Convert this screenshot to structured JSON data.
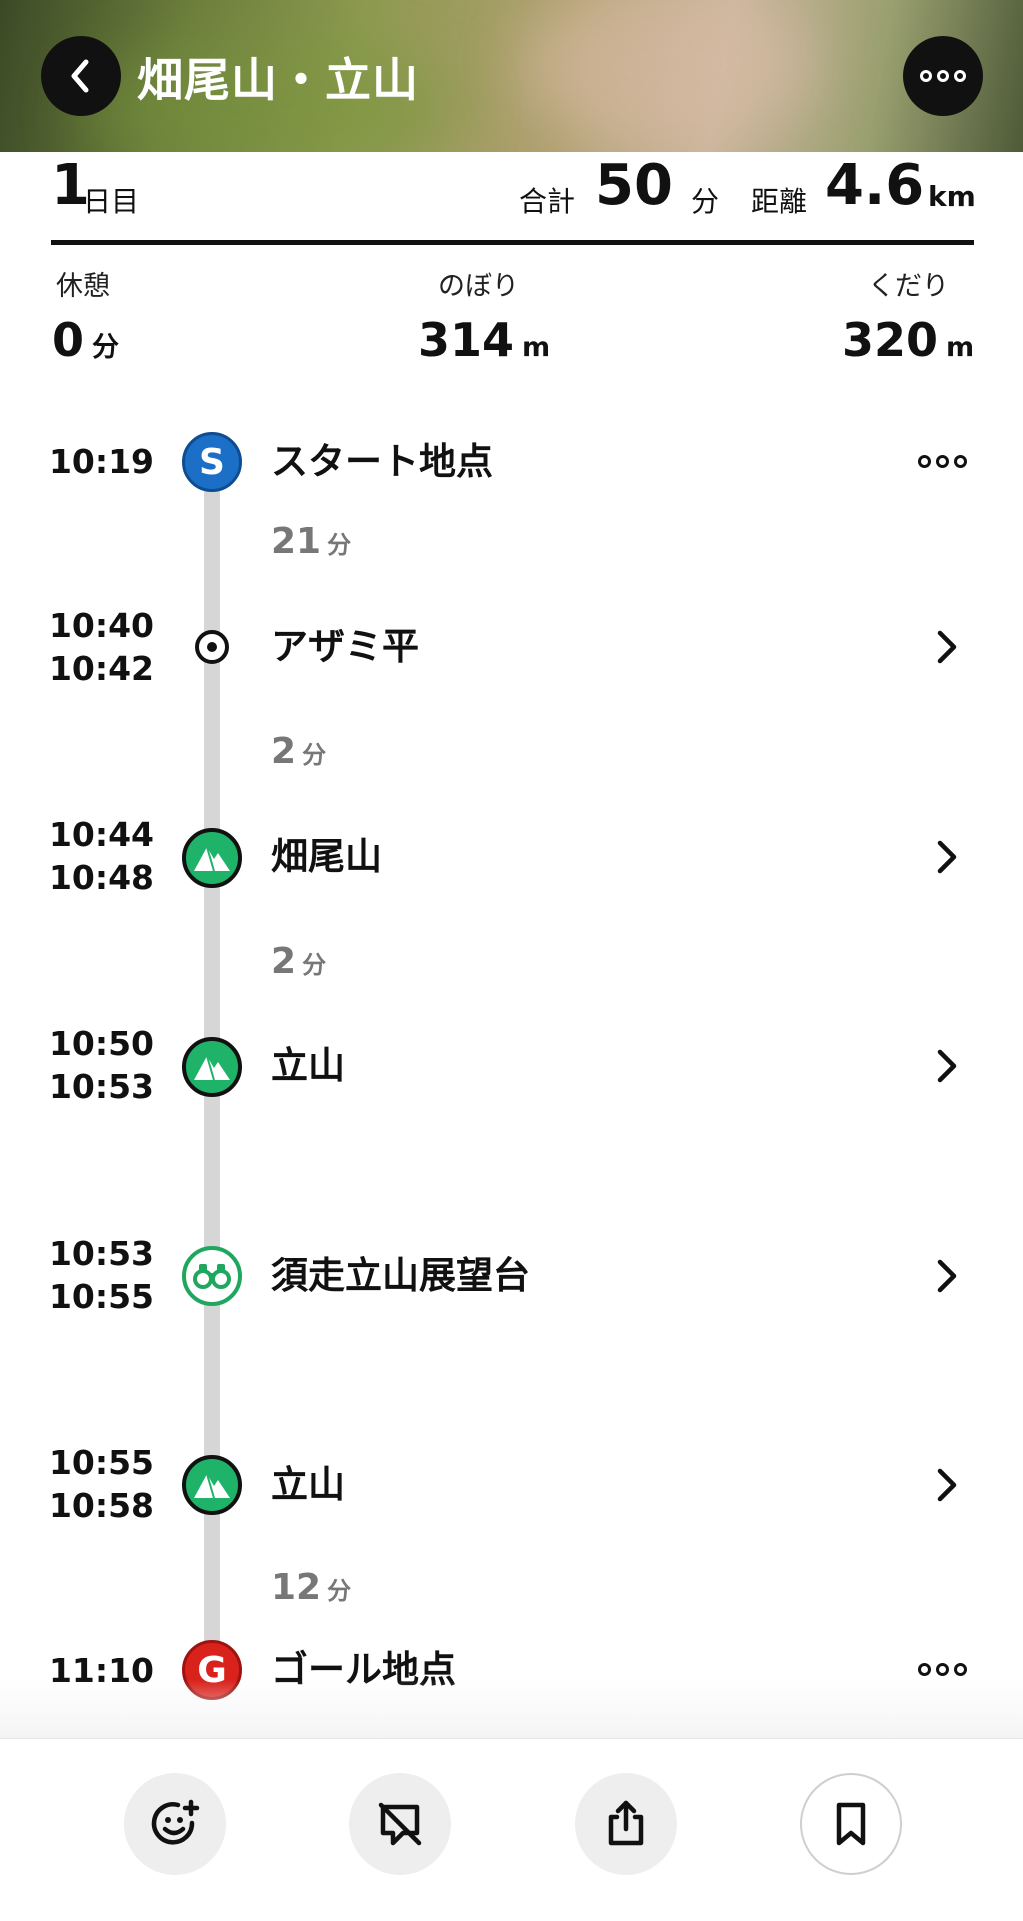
{
  "header": {
    "title": "畑尾山・立山",
    "back_icon": "chevron-left-icon",
    "more_icon": "more-horizontal-icon"
  },
  "summary": {
    "day_number": "1",
    "day_suffix": "日目",
    "total_label": "合計",
    "total_value": "50",
    "total_unit": "分",
    "distance_label": "距離",
    "distance_value": "4.6",
    "distance_unit": "km",
    "rest_label": "休憩",
    "rest_value": "0",
    "rest_unit": "分",
    "ascent_label": "のぼり",
    "ascent_value": "314",
    "ascent_unit": "m",
    "descent_label": "くだり",
    "descent_value": "320",
    "descent_unit": "m"
  },
  "timeline": {
    "start": {
      "time": "10:19",
      "badge": "S",
      "name": "スタート地点"
    },
    "seg1": {
      "value": "21",
      "unit": "分"
    },
    "p1": {
      "arrive": "10:40",
      "depart": "10:42",
      "name": "アザミ平"
    },
    "seg2": {
      "value": "2",
      "unit": "分"
    },
    "p2": {
      "arrive": "10:44",
      "depart": "10:48",
      "name": "畑尾山"
    },
    "seg3": {
      "value": "2",
      "unit": "分"
    },
    "p3": {
      "arrive": "10:50",
      "depart": "10:53",
      "name": "立山"
    },
    "p4": {
      "arrive": "10:53",
      "depart": "10:55",
      "name": "須走立山展望台"
    },
    "p5": {
      "arrive": "10:55",
      "depart": "10:58",
      "name": "立山"
    },
    "seg6": {
      "value": "12",
      "unit": "分"
    },
    "goal": {
      "time": "11:10",
      "badge": "G",
      "name": "ゴール地点"
    }
  },
  "toolbar": {
    "icons": [
      "add-emoji-icon",
      "map-off-icon",
      "share-icon",
      "bookmark-icon"
    ]
  },
  "colors": {
    "start": "#1b6fc6",
    "goal": "#d9221c",
    "mountain": "#1fb36a",
    "line": "#d6d6d6"
  }
}
